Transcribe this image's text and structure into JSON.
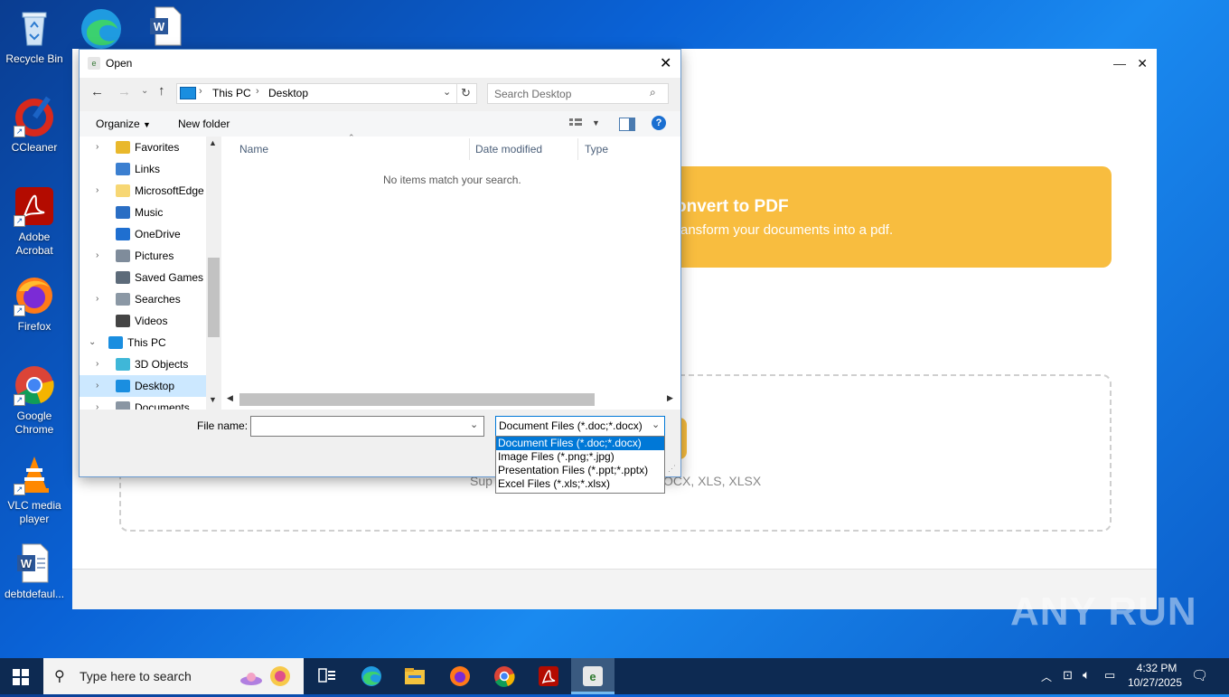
{
  "desktop": {
    "icons": [
      {
        "label": "Recycle Bin",
        "name": "recycle-bin-icon"
      },
      {
        "label": "CCleaner",
        "name": "ccleaner-icon"
      },
      {
        "label": "Adobe\nAcrobat",
        "name": "adobe-acrobat-icon"
      },
      {
        "label": "Firefox",
        "name": "firefox-icon"
      },
      {
        "label": "Google\nChrome",
        "name": "chrome-icon"
      },
      {
        "label": "VLC media\nplayer",
        "name": "vlc-icon"
      },
      {
        "label": "debtdefaul...",
        "name": "word-document-icon"
      }
    ]
  },
  "background_app": {
    "banner_title": "onvert to PDF",
    "banner_subtitle": "ransform your documents into a pdf.",
    "supported_prefix": "Sup",
    "supported_suffix": "OCX, XLS, XLSX",
    "minimize": "—",
    "close": "✕"
  },
  "dialog": {
    "title": "Open",
    "close": "✕",
    "breadcrumb": [
      "This PC",
      "Desktop"
    ],
    "search_placeholder": "Search Desktop",
    "organize_label": "Organize",
    "new_folder_label": "New folder",
    "nav_items": [
      {
        "label": "Favorites",
        "expander": "›",
        "icon": "star-icon"
      },
      {
        "label": "Links",
        "expander": "",
        "icon": "links-icon"
      },
      {
        "label": "MicrosoftEdge",
        "expander": "›",
        "icon": "folder-icon"
      },
      {
        "label": "Music",
        "expander": "",
        "icon": "music-icon"
      },
      {
        "label": "OneDrive",
        "expander": "",
        "icon": "onedrive-icon"
      },
      {
        "label": "Pictures",
        "expander": "›",
        "icon": "pictures-icon"
      },
      {
        "label": "Saved Games",
        "expander": "",
        "icon": "saved-games-icon"
      },
      {
        "label": "Searches",
        "expander": "›",
        "icon": "searches-icon"
      },
      {
        "label": "Videos",
        "expander": "",
        "icon": "videos-icon"
      },
      {
        "label": "This PC",
        "expander": "⌄",
        "icon": "this-pc-icon"
      },
      {
        "label": "3D Objects",
        "expander": "›",
        "icon": "3d-objects-icon"
      },
      {
        "label": "Desktop",
        "expander": "›",
        "icon": "desktop-icon"
      },
      {
        "label": "Documents",
        "expander": "›",
        "icon": "documents-icon"
      }
    ],
    "columns": [
      "Name",
      "Date modified",
      "Type"
    ],
    "empty_message": "No items match your search.",
    "file_name_label": "File name:",
    "file_name_value": "",
    "file_type_selected": "Document Files (*.doc;*.docx)",
    "file_type_options": [
      "Document Files (*.doc;*.docx)",
      "Image Files (*.png;*.jpg)",
      "Presentation Files (*.ppt;*.pptx)",
      "Excel Files (*.xls;*.xlsx)"
    ]
  },
  "taskbar": {
    "search_placeholder": "Type here to search",
    "time": "4:32 PM",
    "date": "10/27/2025",
    "pinned": [
      "task-view-icon",
      "edge-icon",
      "file-explorer-icon",
      "firefox-icon",
      "chrome-icon",
      "acrobat-icon",
      "active-app-icon"
    ]
  },
  "watermark": "ANY RUN",
  "colors": {
    "accent": "#0078d7",
    "banner": "#f8bd3f",
    "taskbar": "#0d2a52"
  }
}
